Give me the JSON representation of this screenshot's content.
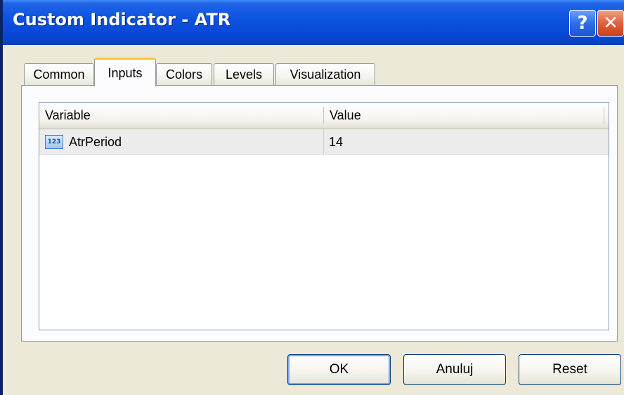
{
  "window": {
    "title": "Custom Indicator - ATR",
    "help_label": "?",
    "close_label": "✕"
  },
  "tabs": [
    {
      "label": "Common",
      "active": false
    },
    {
      "label": "Inputs",
      "active": true
    },
    {
      "label": "Colors",
      "active": false
    },
    {
      "label": "Levels",
      "active": false
    },
    {
      "label": "Visualization",
      "active": false
    }
  ],
  "inputs_table": {
    "columns": [
      "Variable",
      "Value"
    ],
    "rows": [
      {
        "icon": "integer-type-icon",
        "icon_text": "123",
        "variable": "AtrPeriod",
        "value": "14"
      }
    ]
  },
  "buttons": {
    "ok": "OK",
    "cancel": "Anuluj",
    "reset": "Reset"
  },
  "colors": {
    "titlebar": "#0a52df",
    "dialog_bg": "#ece9d8",
    "active_tab_accent": "#ffc83c",
    "close_button": "#e2603a"
  }
}
